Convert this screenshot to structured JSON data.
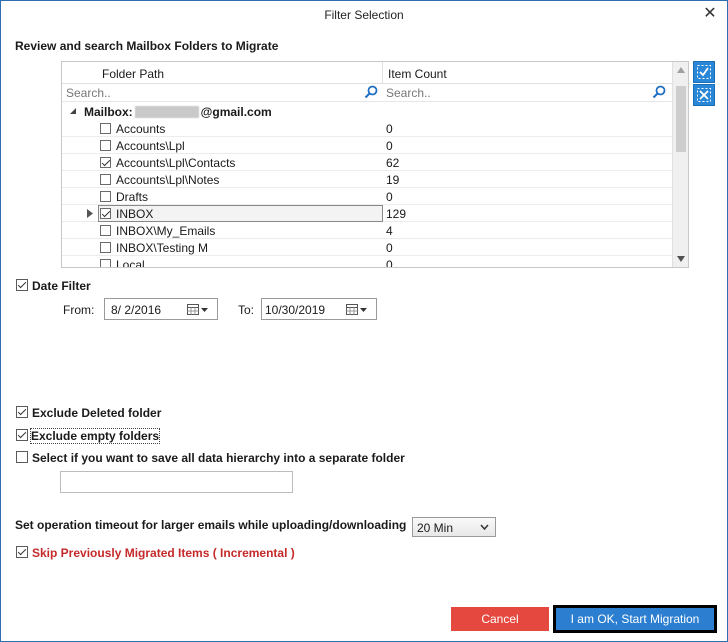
{
  "window": {
    "title": "Filter Selection",
    "close_glyph": "✕"
  },
  "heading": "Review and search Mailbox Folders to Migrate",
  "grid": {
    "columns": [
      "Folder Path",
      "Item Count"
    ],
    "search_placeholder_path": "Search..",
    "search_placeholder_count": "Search..",
    "mailbox_prefix": "Mailbox:",
    "mailbox_suffix": "@gmail.com",
    "rows": [
      {
        "name": "Accounts",
        "count": "0",
        "checked": false
      },
      {
        "name": "Accounts\\Lpl",
        "count": "0",
        "checked": false
      },
      {
        "name": "Accounts\\Lpl\\Contacts",
        "count": "62",
        "checked": true
      },
      {
        "name": "Accounts\\Lpl\\Notes",
        "count": "19",
        "checked": false
      },
      {
        "name": "Drafts",
        "count": "0",
        "checked": false
      },
      {
        "name": "INBOX",
        "count": "129",
        "checked": true,
        "selected": true,
        "expandable": true
      },
      {
        "name": "INBOX\\My_Emails",
        "count": "4",
        "checked": false
      },
      {
        "name": "INBOX\\Testing M",
        "count": "0",
        "checked": false
      },
      {
        "name": "Local",
        "count": "0",
        "checked": false
      }
    ]
  },
  "side_buttons": {
    "select_all_icon": "check-all-icon",
    "deselect_all_icon": "uncheck-all-icon"
  },
  "date_filter": {
    "label": "Date Filter",
    "checked": true,
    "from_label": "From:",
    "from_value": "8/  2/2016",
    "to_label": "To:",
    "to_value": "10/30/2019"
  },
  "options": {
    "exclude_deleted": {
      "label": "Exclude Deleted folder",
      "checked": true
    },
    "exclude_empty": {
      "label": "Exclude empty folders",
      "checked": true
    },
    "save_hierarchy": {
      "label": "Select if you want to save all data hierarchy into a separate folder",
      "checked": false
    },
    "hierarchy_folder_value": ""
  },
  "timeout": {
    "label": "Set operation timeout for larger emails while uploading/downloading",
    "selected": "20 Min"
  },
  "incremental": {
    "label": "Skip Previously Migrated Items ( Incremental )",
    "checked": true
  },
  "buttons": {
    "cancel": "Cancel",
    "ok": "I am OK, Start Migration"
  },
  "colors": {
    "accent_blue": "#2c7fd0",
    "cancel_red": "#e4483f",
    "incremental_red": "#c52a2a"
  }
}
